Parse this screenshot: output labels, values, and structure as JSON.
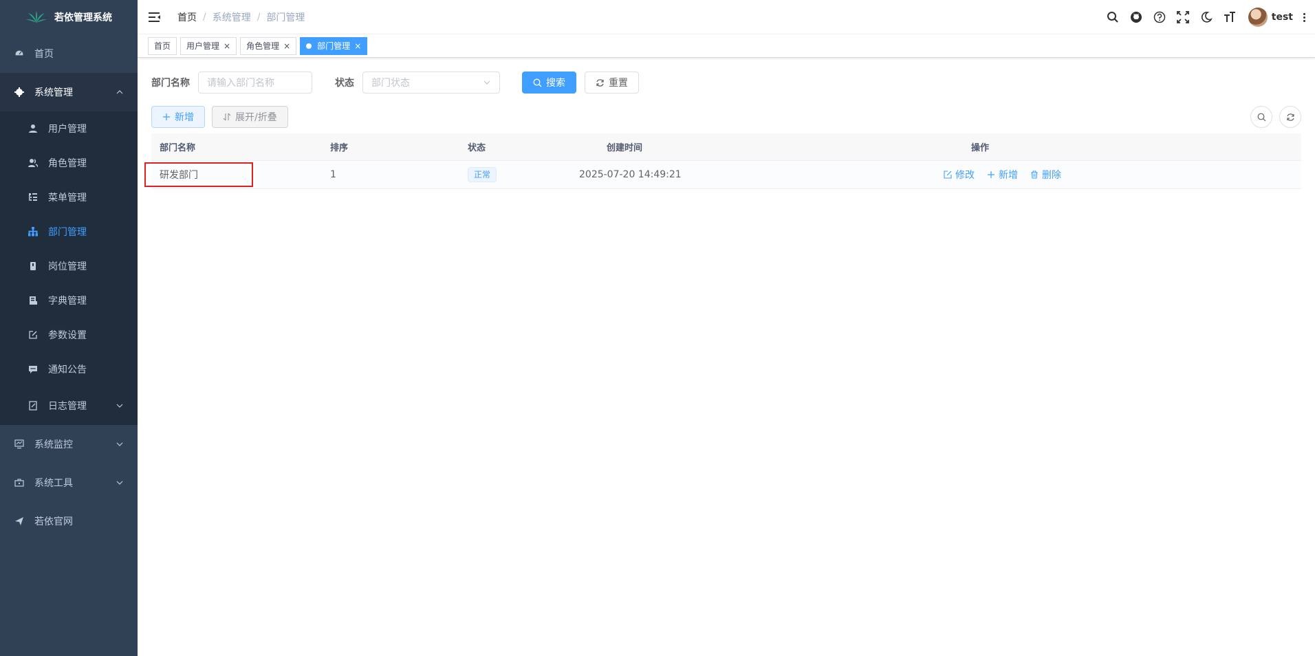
{
  "app": {
    "title": "若依管理系统"
  },
  "sidebar": {
    "items": [
      {
        "label": "首页",
        "icon": "dashboard-icon"
      },
      {
        "label": "系统管理",
        "icon": "gear-icon",
        "expanded": true,
        "children": [
          {
            "label": "用户管理",
            "icon": "user-icon"
          },
          {
            "label": "角色管理",
            "icon": "peoples-icon"
          },
          {
            "label": "菜单管理",
            "icon": "tree-table-icon"
          },
          {
            "label": "部门管理",
            "icon": "tree-icon",
            "active": true
          },
          {
            "label": "岗位管理",
            "icon": "post-icon"
          },
          {
            "label": "字典管理",
            "icon": "dict-icon"
          },
          {
            "label": "参数设置",
            "icon": "edit-icon"
          },
          {
            "label": "通知公告",
            "icon": "message-icon"
          },
          {
            "label": "日志管理",
            "icon": "log-icon"
          }
        ]
      },
      {
        "label": "系统监控",
        "icon": "monitor-icon"
      },
      {
        "label": "系统工具",
        "icon": "tool-icon"
      },
      {
        "label": "若依官网",
        "icon": "guide-icon"
      }
    ]
  },
  "breadcrumb": [
    "首页",
    "系统管理",
    "部门管理"
  ],
  "user": {
    "name": "test"
  },
  "tags": [
    {
      "label": "首页",
      "closable": false
    },
    {
      "label": "用户管理",
      "closable": true
    },
    {
      "label": "角色管理",
      "closable": true
    },
    {
      "label": "部门管理",
      "closable": true,
      "active": true
    }
  ],
  "search": {
    "dept_name_label": "部门名称",
    "dept_name_placeholder": "请输入部门名称",
    "status_label": "状态",
    "status_placeholder": "部门状态",
    "search_button": "搜索",
    "reset_button": "重置"
  },
  "toolbar": {
    "add_button": "新增",
    "expand_button": "展开/折叠"
  },
  "table": {
    "headers": [
      "部门名称",
      "排序",
      "状态",
      "创建时间",
      "操作"
    ],
    "rows": [
      {
        "name": "研发部门",
        "order": "1",
        "status": "正常",
        "created": "2025-07-20 14:49:21",
        "actions": [
          "修改",
          "新增",
          "删除"
        ]
      }
    ]
  },
  "colors": {
    "sidebar_bg": "#304156",
    "submenu_bg": "#1f2d3d",
    "primary": "#409eff",
    "highlight": "#e02020"
  }
}
